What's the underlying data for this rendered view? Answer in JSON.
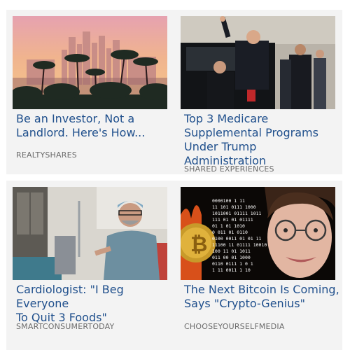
{
  "cards": [
    {
      "title_lines": [
        "Be an Investor, Not a",
        "Landlord. Here's How..."
      ],
      "source": "REALTYSHARES"
    },
    {
      "title_lines": [
        "Top 3 Medicare",
        "Supplemental Programs",
        "Under Trump Administration"
      ],
      "source": "SHARED EXPERIENCES"
    },
    {
      "title_lines": [
        "Cardiologist: \"I Beg Everyone",
        "To Quit 3 Foods\""
      ],
      "source": "SMARTCONSUMERTODAY"
    },
    {
      "title_lines": [
        "The Next Bitcoin Is Coming,",
        "Says \"Crypto-Genius\""
      ],
      "source": "CHOOSEYOURSELFMEDIA"
    }
  ],
  "images": {
    "card1": "los-angeles-skyline-sunset-with-palm-trees",
    "card2": "man-waving-beside-black-suv-with-security-agents",
    "card3": "doctor-in-scrubs-in-hospital-room",
    "card4": "bitcoin-coin-with-binary-digits-and-smiling-man-with-glasses"
  },
  "binary_lines": [
    "0000100 1 11",
    "11 101 0111 1000",
    "1011001 01111 1011",
    "111 01 01 01111",
    "01 1 01 1010",
    "0 011 01 0110",
    "0100 0011 01 01 11",
    "11100 11 01111 10010",
    "100 11 01 1011",
    "011 00 01 1000",
    "0110 0111 1 0 1",
    "1 11 0011 1 10"
  ]
}
